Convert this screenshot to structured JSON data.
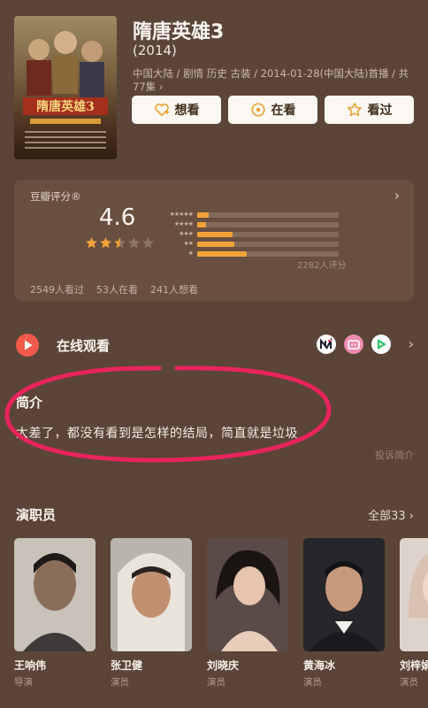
{
  "movie": {
    "title": "隋唐英雄3",
    "year": "(2014)",
    "meta": "中国大陆 / 剧情 历史 古装 / 2014-01-28(中国大陆)首播 / 共77集 ›"
  },
  "actions": [
    {
      "label": "想看",
      "icon": "heart-plus-icon"
    },
    {
      "label": "在看",
      "icon": "target-circle-icon"
    },
    {
      "label": "看过",
      "icon": "star-outline-icon"
    }
  ],
  "rating": {
    "label": "豆瓣评分®",
    "score": "4.6",
    "stars_filled": 2.5,
    "distribution": [
      {
        "stars": "★★★★★",
        "fraction": 0.08
      },
      {
        "stars": "★★★★",
        "fraction": 0.06
      },
      {
        "stars": "★★★",
        "fraction": 0.25
      },
      {
        "stars": "★★",
        "fraction": 0.26
      },
      {
        "stars": "★",
        "fraction": 0.35
      }
    ],
    "count_label": "2282人评分",
    "watched": "2549人看过",
    "watching": "53人在看",
    "wish": "241人想看"
  },
  "watch": {
    "title": "在线观看",
    "platforms": [
      "mgtv",
      "bilibili",
      "iqiyi"
    ]
  },
  "intro": {
    "title": "简介",
    "text": "太差了，都没有看到是怎样的结局，简直就是垃圾",
    "complaint": "投诉简介"
  },
  "cast": {
    "title": "演职员",
    "all_label": "全部33 ›",
    "members": [
      {
        "name": "王响伟",
        "role": "导演"
      },
      {
        "name": "张卫健",
        "role": "演员"
      },
      {
        "name": "刘晓庆",
        "role": "演员"
      },
      {
        "name": "黄海冰",
        "role": "演员"
      },
      {
        "name": "刘梓娟",
        "role": "演员"
      }
    ]
  },
  "colors": {
    "background": "#5a4538",
    "card": "#684f40",
    "accent_orange": "#f2a238",
    "annotation_circle": "#e8245c"
  }
}
